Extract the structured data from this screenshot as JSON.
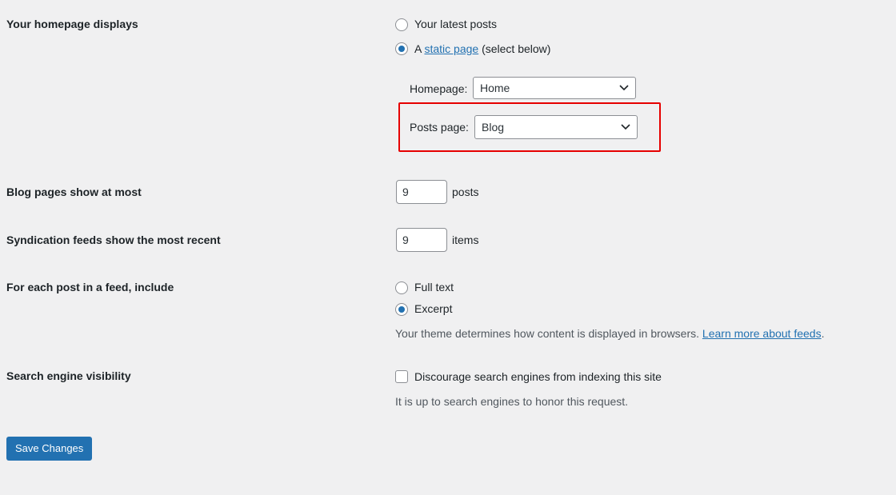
{
  "homepage_displays": {
    "label": "Your homepage displays",
    "option_latest": "Your latest posts",
    "option_static_prefix": "A",
    "option_static_link": "static page",
    "option_static_suffix": "(select below)",
    "selected": "static page",
    "homepage_label": "Homepage:",
    "homepage_value": "Home",
    "posts_page_label": "Posts page:",
    "posts_page_value": "Blog"
  },
  "blog_pages": {
    "label": "Blog pages show at most",
    "value": "9",
    "unit": "posts"
  },
  "syndication": {
    "label": "Syndication feeds show the most recent",
    "value": "9",
    "unit": "items"
  },
  "feed_include": {
    "label": "For each post in a feed, include",
    "option_full": "Full text",
    "option_excerpt": "Excerpt",
    "selected": "Excerpt",
    "desc_prefix": "Your theme determines how content is displayed in browsers.",
    "desc_link": "Learn more about feeds",
    "desc_suffix": "."
  },
  "search_visibility": {
    "label": "Search engine visibility",
    "checkbox_label": "Discourage search engines from indexing this site",
    "checked": false,
    "desc": "It is up to search engines to honor this request."
  },
  "save_button": "Save Changes",
  "colors": {
    "accent": "#2271b1",
    "highlight": "#e60000",
    "background": "#f0f0f1"
  }
}
